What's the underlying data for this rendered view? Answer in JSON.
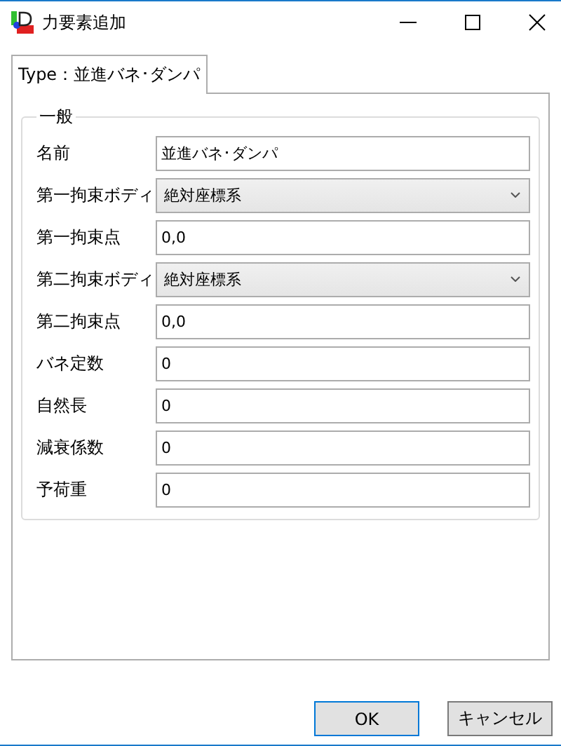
{
  "window": {
    "title": "力要素追加"
  },
  "tabs": [
    {
      "label": "Type：並進バネ･ダンパ",
      "selected": true
    }
  ],
  "group": {
    "title": "一般",
    "fields": [
      {
        "label": "名前",
        "kind": "text",
        "value": "並進バネ･ダンパ"
      },
      {
        "label": "第一拘束ボディ",
        "kind": "select",
        "value": "絶対座標系"
      },
      {
        "label": "第一拘束点",
        "kind": "text",
        "value": "0,0"
      },
      {
        "label": "第二拘束ボディ",
        "kind": "select",
        "value": "絶対座標系"
      },
      {
        "label": "第二拘束点",
        "kind": "text",
        "value": "0,0"
      },
      {
        "label": "バネ定数",
        "kind": "text",
        "value": "0"
      },
      {
        "label": "自然長",
        "kind": "text",
        "value": "0"
      },
      {
        "label": "減衰係数",
        "kind": "text",
        "value": "0"
      },
      {
        "label": "予荷重",
        "kind": "text",
        "value": "0"
      }
    ]
  },
  "buttons": [
    {
      "label": "OK",
      "default": true
    },
    {
      "label": "キャンセル",
      "default": false
    }
  ]
}
